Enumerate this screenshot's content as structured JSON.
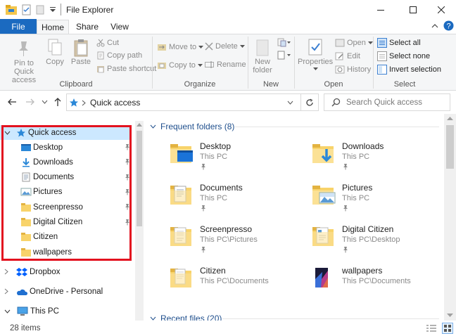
{
  "window": {
    "title": "File Explorer",
    "status": "28 items"
  },
  "tabs": {
    "file": "File",
    "home": "Home",
    "share": "Share",
    "view": "View"
  },
  "ribbon": {
    "pin_quick_access": "Pin to Quick access",
    "pin_line1": "Pin to Quick",
    "pin_line2": "access",
    "copy": "Copy",
    "paste": "Paste",
    "cut": "Cut",
    "copy_path": "Copy path",
    "paste_shortcut": "Paste shortcut",
    "move_to": "Move to",
    "copy_to": "Copy to",
    "delete": "Delete",
    "rename": "Rename",
    "new_folder_line1": "New",
    "new_folder_line2": "folder",
    "properties": "Properties",
    "open": "Open",
    "edit": "Edit",
    "history": "History",
    "select_all": "Select all",
    "select_none": "Select none",
    "invert_selection": "Invert selection",
    "groups": {
      "clipboard": "Clipboard",
      "organize": "Organize",
      "new": "New",
      "open": "Open",
      "select": "Select"
    }
  },
  "address": {
    "location": "Quick access",
    "search_placeholder": "Search Quick access"
  },
  "nav": {
    "quick_access": "Quick access",
    "items": [
      {
        "label": "Desktop",
        "icon": "desktop-icon",
        "pinned": true
      },
      {
        "label": "Downloads",
        "icon": "downloads-icon",
        "pinned": true
      },
      {
        "label": "Documents",
        "icon": "documents-icon",
        "pinned": true
      },
      {
        "label": "Pictures",
        "icon": "pictures-icon",
        "pinned": true
      },
      {
        "label": "Screenpresso",
        "icon": "folder-icon",
        "pinned": true
      },
      {
        "label": "Digital Citizen",
        "icon": "folder-icon",
        "pinned": true
      },
      {
        "label": "Citizen",
        "icon": "folder-icon",
        "pinned": false
      },
      {
        "label": "wallpapers",
        "icon": "folder-icon",
        "pinned": false
      }
    ],
    "dropbox": "Dropbox",
    "onedrive": "OneDrive - Personal",
    "this_pc": "This PC"
  },
  "content": {
    "frequent_header": "Frequent folders (8)",
    "recent_header": "Recent files (20)",
    "folders": [
      {
        "name": "Desktop",
        "path": "This PC",
        "pinned": true
      },
      {
        "name": "Downloads",
        "path": "This PC",
        "pinned": true
      },
      {
        "name": "Documents",
        "path": "This PC",
        "pinned": true
      },
      {
        "name": "Pictures",
        "path": "This PC",
        "pinned": true
      },
      {
        "name": "Screenpresso",
        "path": "This PC\\Pictures",
        "pinned": true
      },
      {
        "name": "Digital Citizen",
        "path": "This PC\\Desktop",
        "pinned": true
      },
      {
        "name": "Citizen",
        "path": "This PC\\Documents",
        "pinned": false
      },
      {
        "name": "wallpapers",
        "path": "This PC\\Documents",
        "pinned": false
      }
    ]
  },
  "colors": {
    "accent": "#1b6ac0",
    "highlight_border": "#e3121f",
    "folder_yellow": "#f8d36a"
  }
}
